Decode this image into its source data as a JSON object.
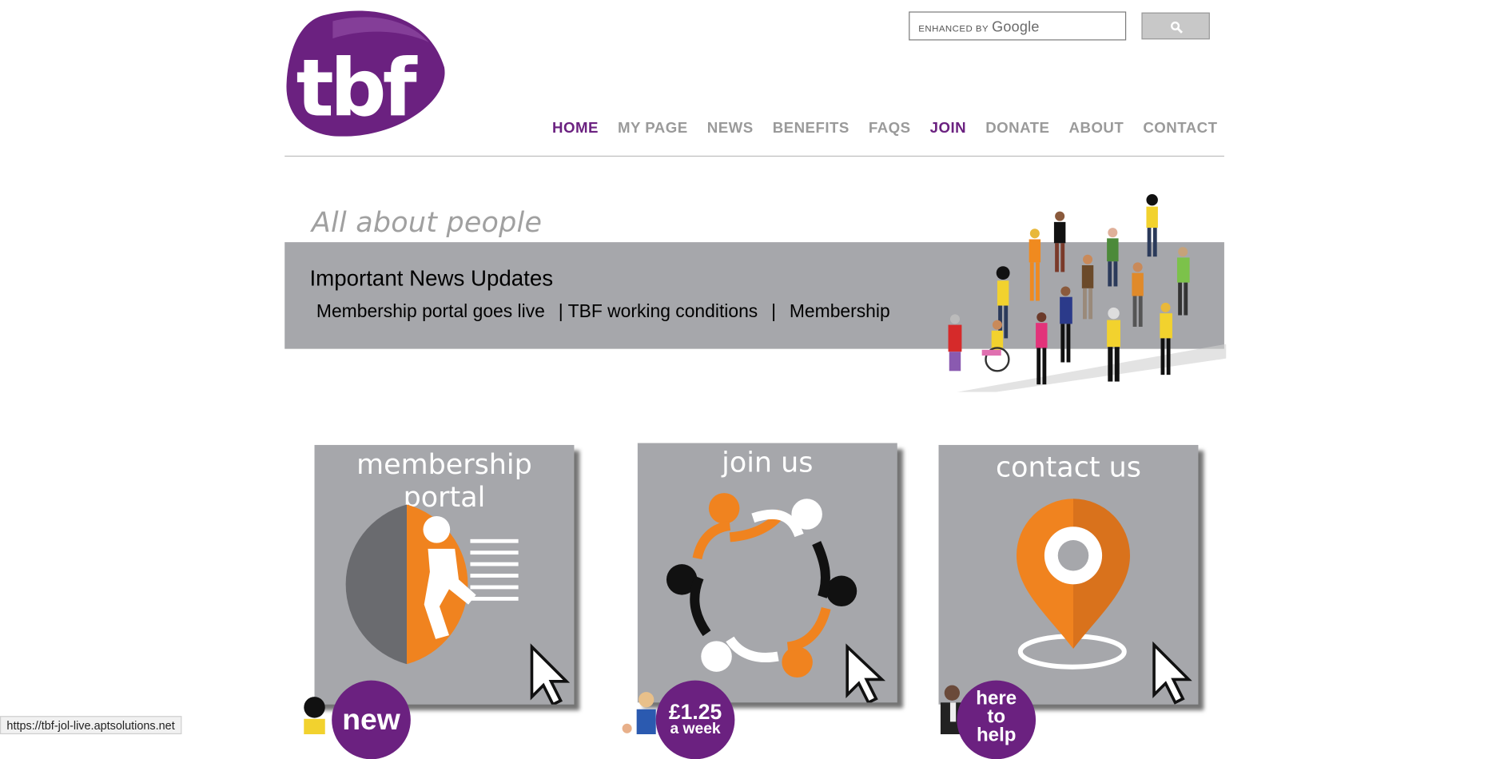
{
  "logo": {
    "text": "tbf"
  },
  "search": {
    "enhanced_label": "ENHANCED BY",
    "brand": "Google"
  },
  "nav": [
    {
      "label": "HOME",
      "active": true
    },
    {
      "label": "MY PAGE",
      "active": false
    },
    {
      "label": "NEWS",
      "active": false
    },
    {
      "label": "BENEFITS",
      "active": false
    },
    {
      "label": "FAQS",
      "active": false
    },
    {
      "label": "JOIN",
      "active": true
    },
    {
      "label": "DONATE",
      "active": false
    },
    {
      "label": "ABOUT",
      "active": false
    },
    {
      "label": "CONTACT",
      "active": false
    }
  ],
  "hero": {
    "tagline": "All about people",
    "news_title": "Important News Updates",
    "ticker": [
      "Membership portal goes live",
      "| TBF working conditions",
      "|",
      "Membership"
    ]
  },
  "cards": [
    {
      "title": "membership portal",
      "badge": "new"
    },
    {
      "title": "join us",
      "badge_line1": "£1.25",
      "badge_line2": "a week"
    },
    {
      "title": "contact us",
      "badge_line1": "here",
      "badge_line2": "to",
      "badge_line3": "help"
    }
  ],
  "status_bar": {
    "url": "https://tbf-jol-live.aptsolutions.net"
  },
  "colors": {
    "brand_purple": "#6b2180",
    "accent_orange": "#f0831f",
    "band_grey": "#a6a7ab"
  },
  "icons": [
    "search-icon",
    "portal-door-icon",
    "people-circle-icon",
    "map-pin-icon",
    "cursor-arrow-icon"
  ]
}
